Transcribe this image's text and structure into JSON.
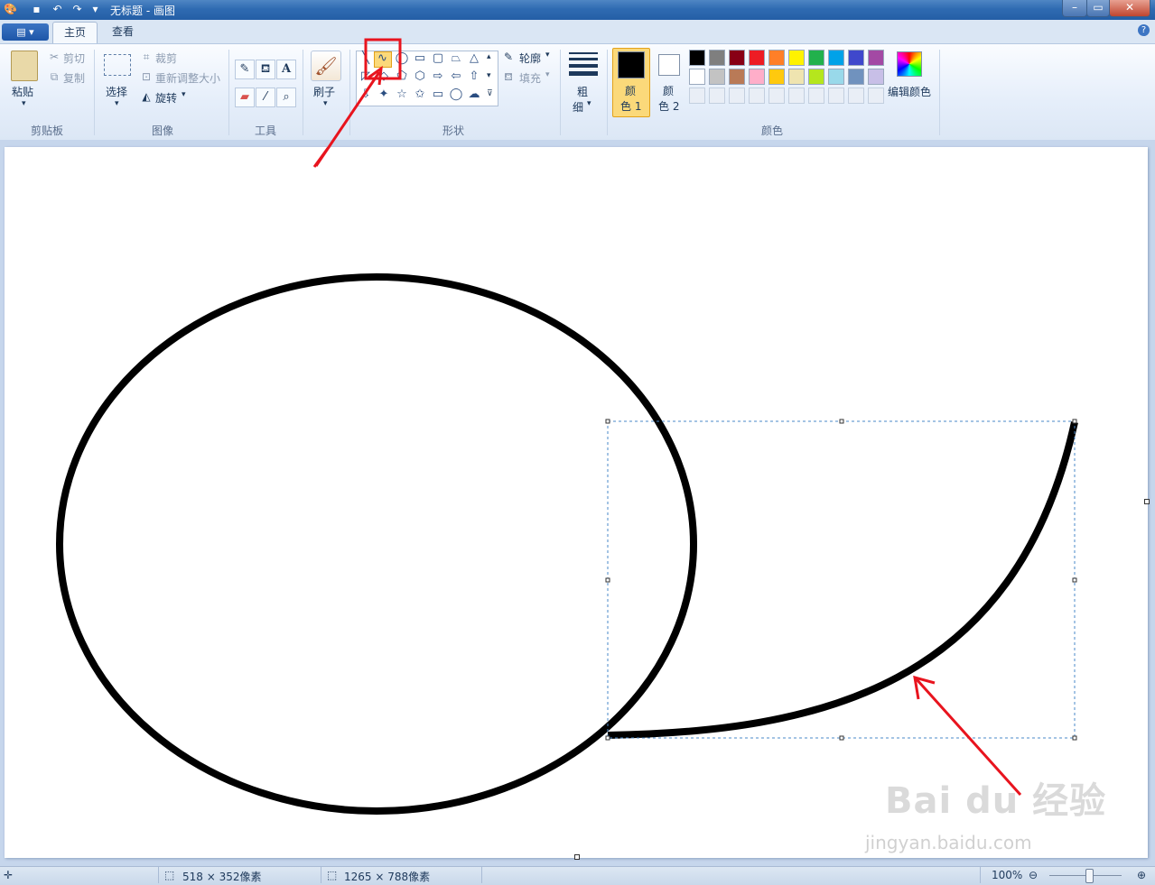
{
  "window": {
    "title": "无标题 - 画图"
  },
  "tabs": {
    "file_menu": "▤ ▾",
    "home": "主页",
    "view": "查看"
  },
  "clipboard": {
    "paste": "粘贴",
    "cut": "剪切",
    "copy": "复制",
    "group": "剪贴板"
  },
  "image": {
    "select": "选择",
    "crop": "裁剪",
    "resize": "重新调整大小",
    "rotate": "旋转",
    "group": "图像"
  },
  "tools": {
    "group": "工具"
  },
  "brushes": {
    "label": "刷子"
  },
  "shapes": {
    "outline": "轮廓",
    "fill": "填充",
    "group": "形状",
    "items": [
      "╲",
      "∿",
      "◯",
      "▭",
      "▢",
      "⏢",
      "△",
      "◸",
      "◇",
      "⬠",
      "⬡",
      "⇨",
      "⇦",
      "⇧",
      "⇩",
      "✦",
      "☆",
      "✩",
      "▭",
      "◯",
      "☁"
    ]
  },
  "size": {
    "label_line1": "粗",
    "label_line2": "细"
  },
  "colors": {
    "color1_line1": "颜",
    "color1_line2": "色 1",
    "color2_line1": "颜",
    "color2_line2": "色 2",
    "edit": "编辑颜色",
    "group": "颜色",
    "color1_value": "#000000",
    "color2_value": "#ffffff",
    "palette_row1": [
      "#000000",
      "#7f7f7f",
      "#880015",
      "#ed1c24",
      "#ff7f27",
      "#fff200",
      "#22b14c",
      "#00a2e8",
      "#3f48cc",
      "#a349a4"
    ],
    "palette_row2": [
      "#ffffff",
      "#c3c3c3",
      "#b97a57",
      "#ffaec9",
      "#ffc90e",
      "#efe4b0",
      "#b5e61d",
      "#99d9ea",
      "#7092be",
      "#c8bfe7"
    ]
  },
  "status": {
    "selection_size": "518 × 352像素",
    "canvas_size": "1265 × 788像素",
    "zoom": "100%"
  },
  "watermark": {
    "text": "Bai du 经验",
    "sub": "jingyan.baidu.com"
  }
}
